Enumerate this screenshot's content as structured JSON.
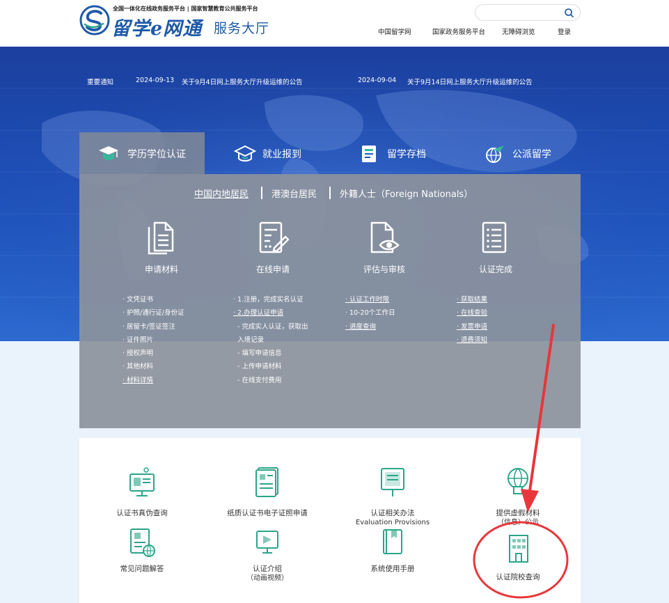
{
  "header": {
    "tagline": "全国一体化在线政务服务平台 | 国家智慧教育公共服务平台",
    "logo_main": "留学e网通",
    "logo_sub": "服务大厅",
    "search_placeholder": "",
    "nav": [
      "中国留学网",
      "国家政务服务平台",
      "无障碍浏览",
      "登录"
    ]
  },
  "notice": {
    "label": "重要通知",
    "items": [
      {
        "date": "2024-09-13",
        "text": "关于9月4日网上服务大厅升级运维的公告"
      },
      {
        "date": "2024-09-04",
        "text": "关于9月14日网上服务大厅升级运维的公告"
      }
    ]
  },
  "tabs": [
    {
      "label": "学历学位认证",
      "icon": "graduation-cap-icon",
      "active": true
    },
    {
      "label": "就业报到",
      "icon": "mortarboard-icon",
      "active": false
    },
    {
      "label": "留学存档",
      "icon": "archive-icon",
      "active": false
    },
    {
      "label": "公派留学",
      "icon": "plane-globe-icon",
      "active": false
    }
  ],
  "resident_tabs": [
    "中国内地居民",
    "港澳台居民",
    "外籍人士（Foreign Nationals）"
  ],
  "steps": [
    {
      "label": "申请材料",
      "items": [
        {
          "text": "· 文凭证书",
          "link": false
        },
        {
          "text": "· 护照/通行证/身份证",
          "link": false
        },
        {
          "text": "· 居留卡/签证签注",
          "link": false
        },
        {
          "text": "· 证件照片",
          "link": false
        },
        {
          "text": "· 授权声明",
          "link": false
        },
        {
          "text": "· 其他材料",
          "link": false
        },
        {
          "text": "· 材料详情",
          "link": true
        }
      ]
    },
    {
      "label": "在线申请",
      "items": [
        {
          "text": "· 1.注册，完成实名认证",
          "link": false
        },
        {
          "text": "· 2.办理认证申请",
          "link": true
        },
        {
          "text": "  - 完成实人认证，获取出",
          "link": false
        },
        {
          "text": "  入境记录",
          "link": false
        },
        {
          "text": "  - 填写申请信息",
          "link": false
        },
        {
          "text": "  - 上传申请材料",
          "link": false
        },
        {
          "text": "  - 在线支付费用",
          "link": false
        }
      ]
    },
    {
      "label": "评估与审核",
      "items": [
        {
          "text": "· 认证工作时限",
          "link": true
        },
        {
          "text": "· 10-20个工作日",
          "link": false
        },
        {
          "text": "· 进度查询",
          "link": true
        }
      ]
    },
    {
      "label": "认证完成",
      "items": [
        {
          "text": "· 获取结果",
          "link": true
        },
        {
          "text": "· 在线查验",
          "link": true
        },
        {
          "text": "· 发票申请",
          "link": true
        },
        {
          "text": "· 退费须知",
          "link": true
        }
      ]
    }
  ],
  "services": [
    {
      "label": "认证书真伪查询",
      "sub": "",
      "icon": "computer-certificate-icon"
    },
    {
      "label": "纸质认证书电子证照申请",
      "sub": "",
      "icon": "document-certificate-icon"
    },
    {
      "label": "认证相关办法",
      "sub": "Evaluation Provisions",
      "icon": "board-document-icon"
    },
    {
      "label": "提供虚假材料",
      "sub": "（信息）公示",
      "icon": "globe-person-icon"
    },
    {
      "label": "常见问题解答",
      "sub": "",
      "icon": "faq-document-icon"
    },
    {
      "label": "认证介绍",
      "sub": "（动画视频）",
      "icon": "video-presentation-icon"
    },
    {
      "label": "系统使用手册",
      "sub": "",
      "icon": "manual-book-icon"
    },
    {
      "label": "认证院校查询",
      "sub": "",
      "icon": "school-building-icon"
    }
  ],
  "colors": {
    "brand_blue": "#1e5aa8",
    "service_green": "#2ba58a",
    "annotation_red": "#e8363a",
    "panel_grey": "#8c929c"
  }
}
